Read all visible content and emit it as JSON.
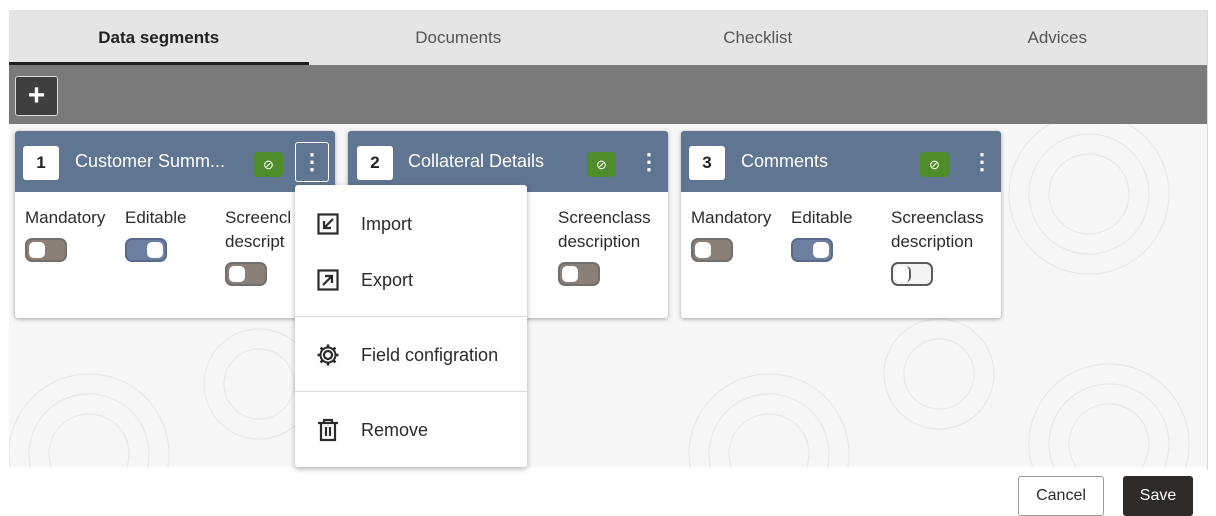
{
  "tabs": [
    {
      "label": "Data segments",
      "active": true
    },
    {
      "label": "Documents",
      "active": false
    },
    {
      "label": "Checklist",
      "active": false
    },
    {
      "label": "Advices",
      "active": false
    }
  ],
  "toolbar": {
    "add_icon": "plus-icon"
  },
  "cards": [
    {
      "number": "1",
      "title": "Customer Summ...",
      "status_icon": "check-circle-icon",
      "menu_icon": "kebab-icon",
      "labels": {
        "mandatory": "Mandatory",
        "editable": "Editable",
        "screenclass_1": "Screencl",
        "screenclass_2": "descript"
      },
      "toggles": {
        "mandatory": "off",
        "editable": "on",
        "screenclass": "off"
      }
    },
    {
      "number": "2",
      "title": "Collateral Details",
      "status_icon": "check-circle-icon",
      "menu_icon": "kebab-icon",
      "labels": {
        "screenclass_1": "Screenclass",
        "screenclass_2": "description"
      },
      "toggles": {
        "screenclass": "off"
      }
    },
    {
      "number": "3",
      "title": "Comments",
      "status_icon": "check-circle-icon",
      "menu_icon": "kebab-icon",
      "labels": {
        "mandatory": "Mandatory",
        "editable": "Editable",
        "screenclass_1": "Screenclass",
        "screenclass_2": "description"
      },
      "toggles": {
        "mandatory": "off",
        "editable": "on",
        "screenclass": "off"
      }
    }
  ],
  "context_menu": {
    "items": [
      {
        "label": "Import",
        "icon": "import-icon"
      },
      {
        "label": "Export",
        "icon": "export-icon"
      },
      {
        "label": "Field configration",
        "icon": "gear-icon"
      },
      {
        "label": "Remove",
        "icon": "trash-icon"
      }
    ]
  },
  "footer": {
    "cancel_label": "Cancel",
    "save_label": "Save"
  },
  "colors": {
    "card_header": "#5f7591",
    "status_green": "#4f8c2a",
    "toolbar": "#7a7a7a",
    "save_bg": "#2d2a28"
  }
}
